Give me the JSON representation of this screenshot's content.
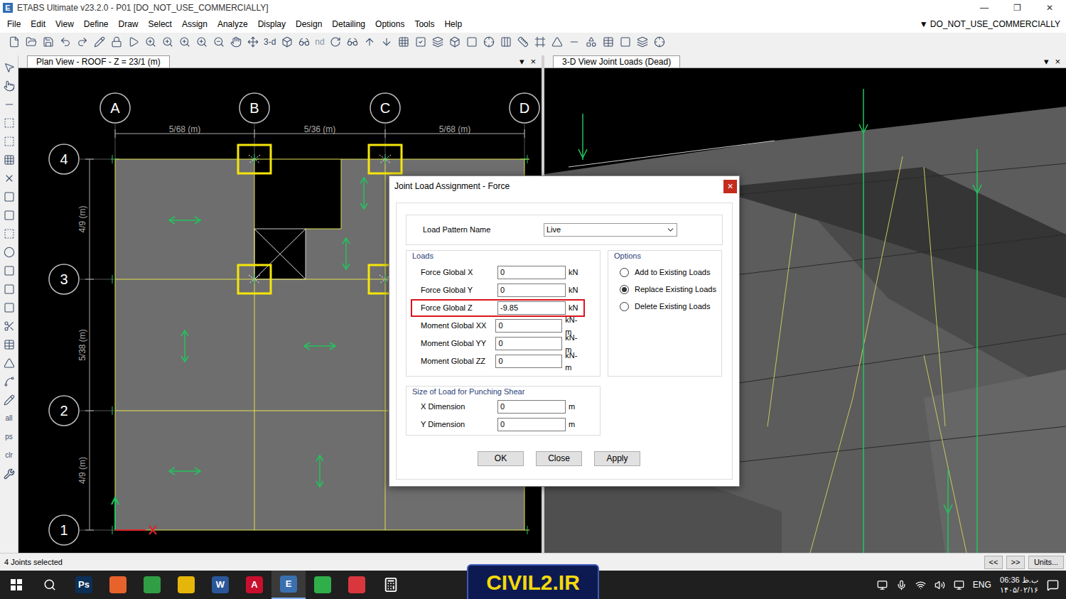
{
  "window": {
    "title": "ETABS Ultimate v23.2.0 - P01  [DO_NOT_USE_COMMERCIALLY]",
    "icon": "E",
    "controls": [
      "—",
      "❐",
      "✕"
    ]
  },
  "menu": [
    "File",
    "Edit",
    "View",
    "Define",
    "Draw",
    "Select",
    "Assign",
    "Analyze",
    "Display",
    "Design",
    "Detailing",
    "Options",
    "Tools",
    "Help"
  ],
  "menu_right": "▼ DO_NOT_USE_COMMERCIALLY",
  "toolbar_texts": [
    "3-d",
    "nd"
  ],
  "side_toolbar_texts": [
    "all",
    "ps",
    "clr"
  ],
  "plan_view": {
    "title": "Plan View - ROOF - Z = 23/1 (m)",
    "columns": [
      "A",
      "B",
      "C",
      "D"
    ],
    "rows": [
      "4",
      "3",
      "2",
      "1"
    ],
    "x_dims": [
      "5/68 (m)",
      "5/36 (m)",
      "5/68 (m)"
    ],
    "y_dims": [
      "4/9 (m)",
      "5/38 (m)",
      "4/9 (m)"
    ],
    "joints": [
      {
        "selected": true
      },
      {
        "selected": true
      },
      {
        "selected": true
      },
      {
        "selected": true
      }
    ]
  },
  "view3d": {
    "title": "3-D View  Joint Loads (Dead)"
  },
  "tab_controls": [
    "▾",
    "×"
  ],
  "dialog": {
    "title": "Joint Load Assignment - Force",
    "close": "×",
    "pattern_label": "Load Pattern Name",
    "pattern_value": "Live",
    "loads_title": "Loads",
    "loads": [
      {
        "label": "Force Global X",
        "value": "0",
        "unit": "kN",
        "highlighted": false
      },
      {
        "label": "Force Global Y",
        "value": "0",
        "unit": "kN",
        "highlighted": false
      },
      {
        "label": "Force Global Z",
        "value": "-9.85",
        "unit": "kN",
        "highlighted": true
      },
      {
        "label": "Moment Global XX",
        "value": "0",
        "unit": "kN-m",
        "highlighted": false
      },
      {
        "label": "Moment Global YY",
        "value": "0",
        "unit": "kN-m",
        "highlighted": false
      },
      {
        "label": "Moment Global ZZ",
        "value": "0",
        "unit": "kN-m",
        "highlighted": false
      }
    ],
    "options_title": "Options",
    "options": [
      {
        "label": "Add to Existing Loads",
        "selected": false
      },
      {
        "label": "Replace Existing Loads",
        "selected": true
      },
      {
        "label": "Delete Existing Loads",
        "selected": false
      }
    ],
    "punching_title": "Size of Load for Punching Shear",
    "punching": [
      {
        "label": "X Dimension",
        "value": "0",
        "unit": "m"
      },
      {
        "label": "Y Dimension",
        "value": "0",
        "unit": "m"
      }
    ],
    "buttons": [
      "OK",
      "Close",
      "Apply"
    ]
  },
  "status_bar": {
    "text": "4 Joints selected",
    "buttons": [
      "<<",
      ">>",
      "Units..."
    ]
  },
  "taskbar": {
    "apps": [
      {
        "label": "Ps",
        "color": "#0b2f57",
        "active": false
      },
      {
        "label": "",
        "color": "#e8622c",
        "active": false
      },
      {
        "label": "",
        "color": "#2f9e44",
        "active": false
      },
      {
        "label": "",
        "color": "#e5b50a",
        "active": false
      },
      {
        "label": "W",
        "color": "#2b579a",
        "active": false
      },
      {
        "label": "A",
        "color": "#c8102e",
        "active": false
      },
      {
        "label": "E",
        "color": "#3a6fb0",
        "active": true
      },
      {
        "label": "",
        "color": "#2fae4a",
        "active": false
      },
      {
        "label": "",
        "color": "#d9363e",
        "active": false
      }
    ],
    "banner": "CIVIL2.IR",
    "lang": "ENG",
    "time": "06:36 ب.ظ",
    "date": "۱۴۰۵/۰۲/۱۶"
  }
}
